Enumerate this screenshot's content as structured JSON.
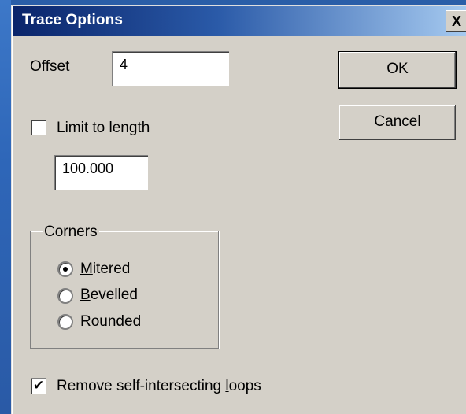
{
  "window": {
    "title": "Trace Options",
    "close_glyph": "X"
  },
  "offset": {
    "label_prefix": "O",
    "label_rest": "ffset",
    "value": "4"
  },
  "buttons": {
    "ok": "OK",
    "cancel": "Cancel"
  },
  "limit": {
    "label": "Limit to length",
    "checked": false,
    "check_glyph": "",
    "value": "100.000"
  },
  "corners": {
    "label": "Corners",
    "options": [
      {
        "prefix": "M",
        "rest": "itered",
        "selected": true
      },
      {
        "prefix": "B",
        "rest": "evelled",
        "selected": false
      },
      {
        "prefix": "R",
        "rest": "ounded",
        "selected": false
      }
    ]
  },
  "loops": {
    "label_before": "Remove self-intersecting ",
    "label_u": "l",
    "label_after": "oops",
    "checked": true,
    "check_glyph": "✔"
  },
  "icons": {
    "close": "close-icon",
    "check": "checkmark-icon",
    "radio_dot": "radio-dot-icon"
  }
}
